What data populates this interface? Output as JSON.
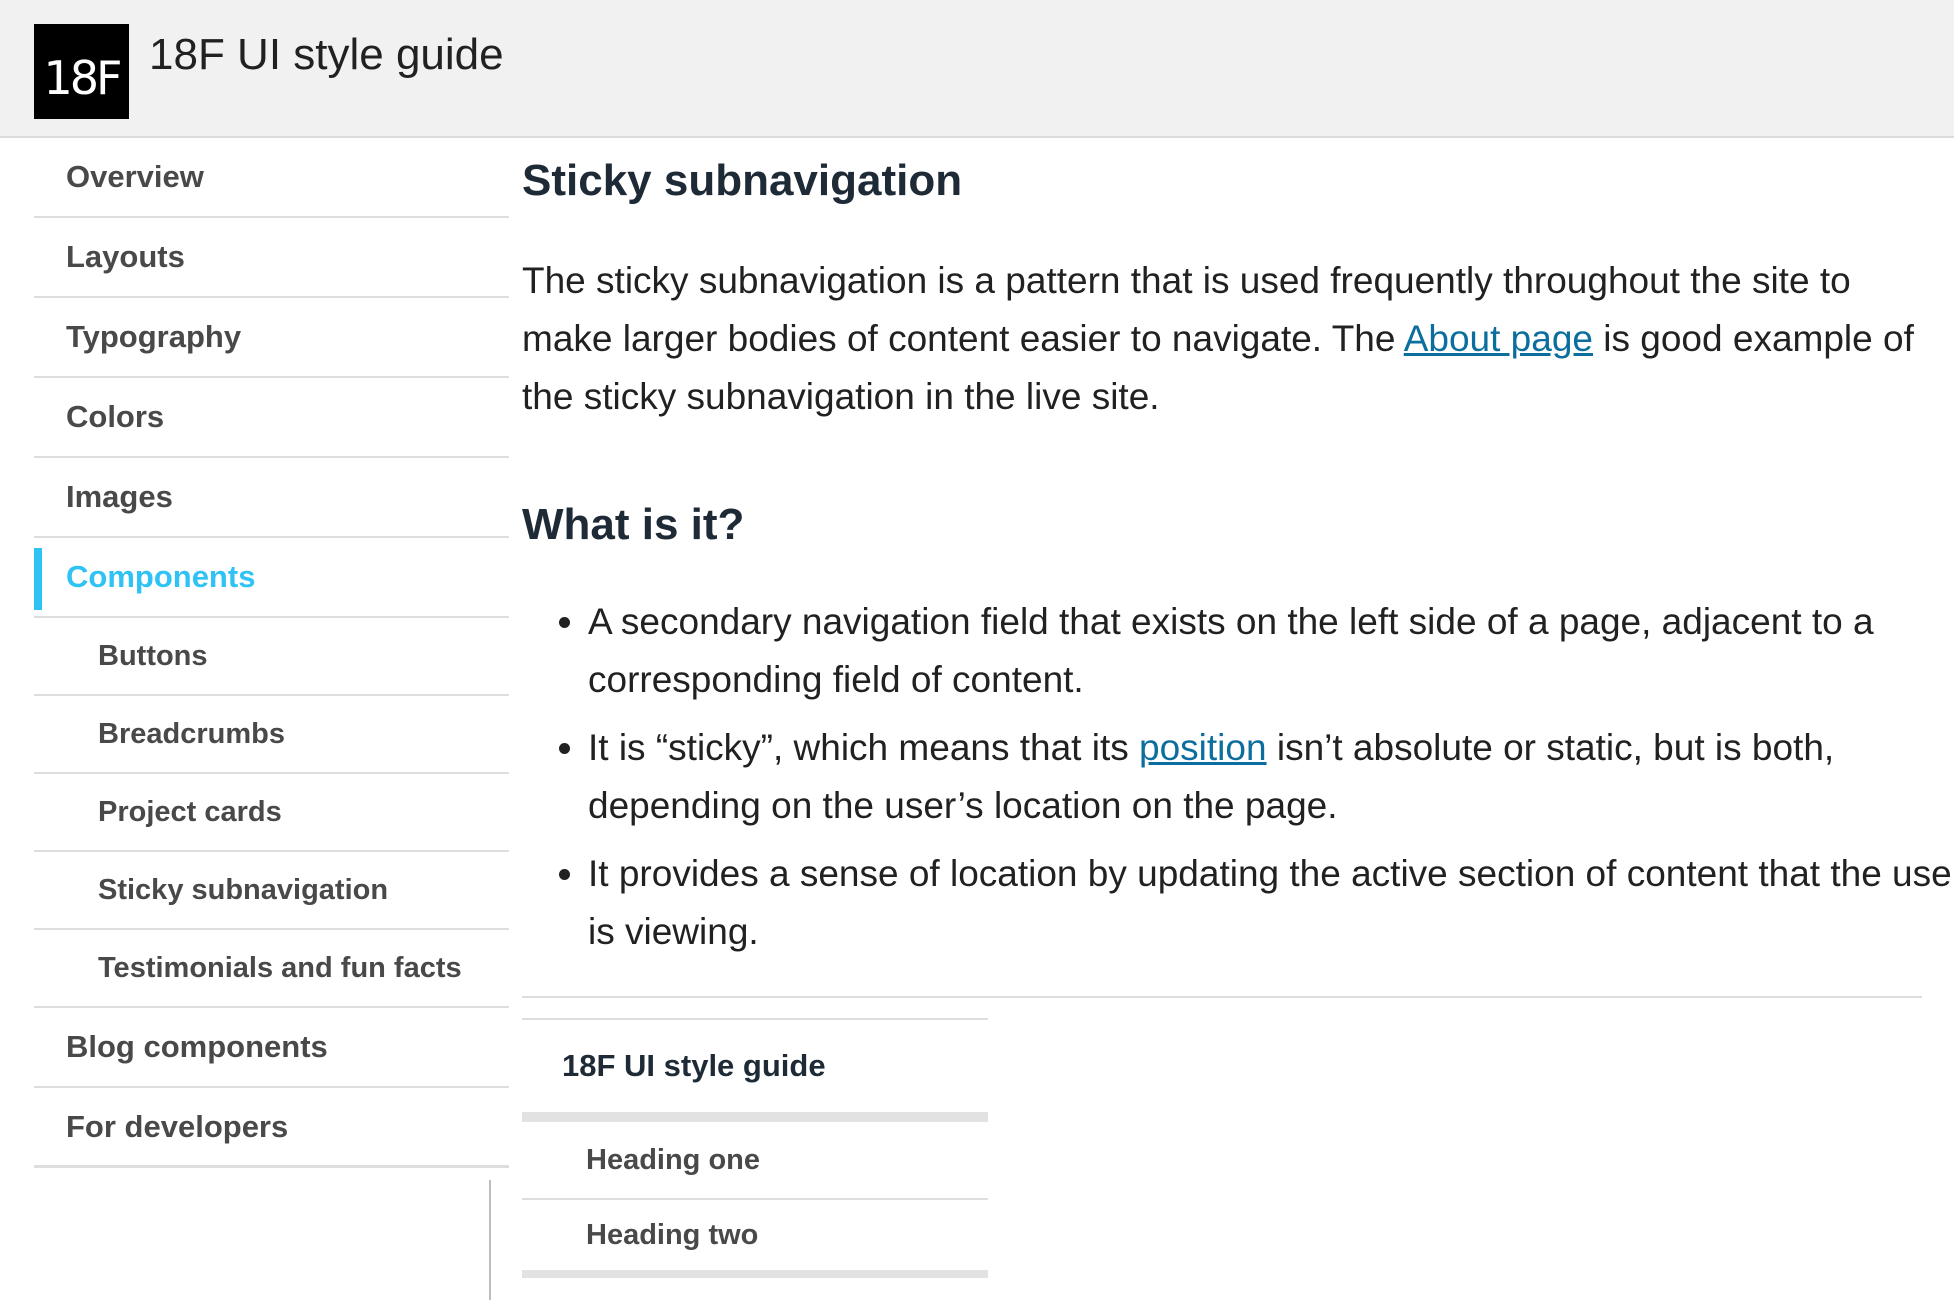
{
  "header": {
    "logo_text": "18F",
    "site_title": "18F UI style guide"
  },
  "sidebar": {
    "items": [
      {
        "label": "Overview",
        "level": 1,
        "active": false
      },
      {
        "label": "Layouts",
        "level": 1,
        "active": false
      },
      {
        "label": "Typography",
        "level": 1,
        "active": false
      },
      {
        "label": "Colors",
        "level": 1,
        "active": false
      },
      {
        "label": "Images",
        "level": 1,
        "active": false
      },
      {
        "label": "Components",
        "level": 1,
        "active": true
      },
      {
        "label": "Buttons",
        "level": 2,
        "active": false
      },
      {
        "label": "Breadcrumbs",
        "level": 2,
        "active": false
      },
      {
        "label": "Project cards",
        "level": 2,
        "active": false
      },
      {
        "label": "Sticky subnavigation",
        "level": 2,
        "active": false
      },
      {
        "label": "Testimonials and fun facts",
        "level": 2,
        "active": false
      },
      {
        "label": "Blog components",
        "level": 1,
        "active": false
      },
      {
        "label": "For developers",
        "level": 1,
        "active": false
      }
    ],
    "active_color": "#2ec3f4"
  },
  "main": {
    "title": "Sticky subnavigation",
    "intro_before_link": "The sticky subnavigation is a pattern that is used frequently throughout the site to make larger bodies of content easier to navigate. The ",
    "intro_link": "About page",
    "intro_after_link": " is good example of the sticky subnavigation in the live site.",
    "section_heading": "What is it?",
    "bullets": [
      {
        "text": "A secondary navigation field that exists on the left side of a page, adjacent to a corresponding field of content."
      },
      {
        "before": "It is “sticky”, which means that its ",
        "link": "position",
        "after": " isn’t absolute or static, but is both, depending on the user’s location on the page."
      },
      {
        "text": "It provides a sense of location by updating the active section of content that the user is viewing."
      }
    ],
    "link_color": "#0b6e9e"
  },
  "demo": {
    "title": "18F UI style guide",
    "items": [
      "Heading one",
      "Heading two"
    ]
  }
}
